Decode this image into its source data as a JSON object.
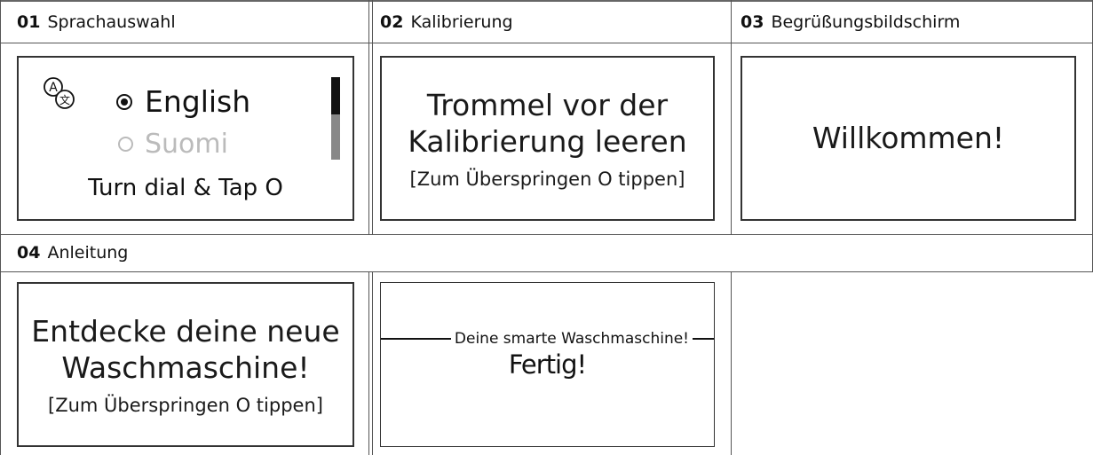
{
  "sections": {
    "s1": {
      "num": "01",
      "title": "Sprachauswahl"
    },
    "s2": {
      "num": "02",
      "title": "Kalibrierung"
    },
    "s3": {
      "num": "03",
      "title": "Begrüßungsbildschirm"
    },
    "s4": {
      "num": "04",
      "title": "Anleitung"
    }
  },
  "screen1": {
    "option_selected": "English",
    "option_unselected": "Suomi",
    "hint": "Turn dial & Tap O",
    "language_icon": "language-icon",
    "scroll_position": 0.35
  },
  "screen2": {
    "line1": "Trommel vor der",
    "line2": "Kalibrierung leeren",
    "hint": "[Zum Überspringen O tippen]"
  },
  "screen3": {
    "text": "Willkommen!"
  },
  "screen4": {
    "line1": "Entdecke deine neue",
    "line2": "Waschmaschine!",
    "hint": "[Zum Überspringen O tippen]"
  },
  "screen5": {
    "title": "Deine smarte Waschmaschine!",
    "done": "Fertig!"
  }
}
